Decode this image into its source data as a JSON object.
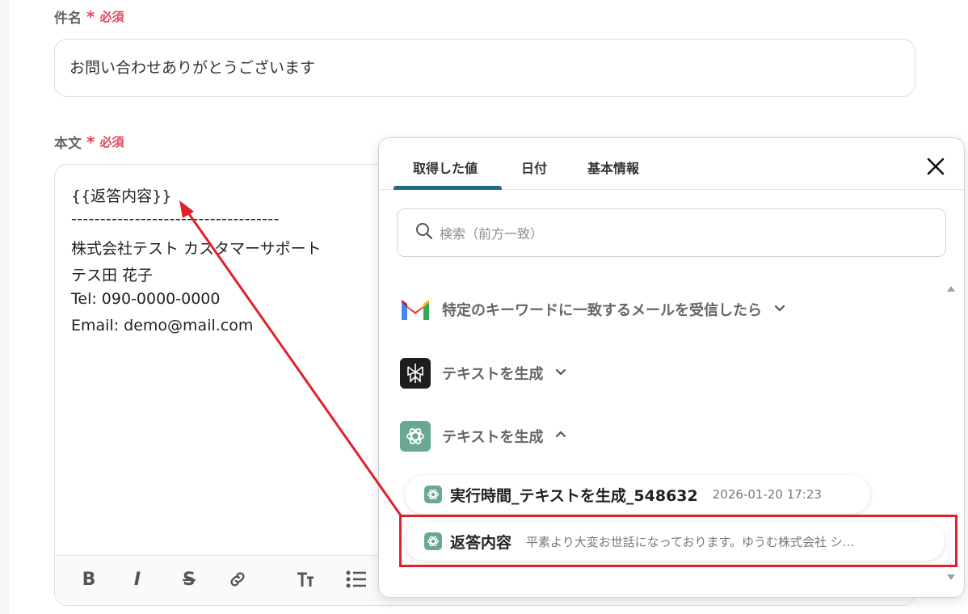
{
  "form": {
    "subject": {
      "label": "件名",
      "required_mark": "*",
      "required_text": "必須",
      "value": "お問い合わせありがとうございます"
    },
    "body": {
      "label": "本文",
      "required_mark": "*",
      "required_text": "必須",
      "lines": [
        "{{返答内容}}",
        "------------------------------------",
        "株式会社テスト カスタマーサポート",
        "テス田 花子",
        "Tel: 090-0000-0000",
        "Email: demo@mail.com"
      ]
    },
    "toolbar": [
      "bold-icon",
      "italic-icon",
      "strikethrough-icon",
      "link-icon",
      "text-size-icon",
      "list-icon"
    ]
  },
  "popup": {
    "tabs": [
      "取得した値",
      "日付",
      "基本情報"
    ],
    "active_tab": "取得した値",
    "search_placeholder": "検索（前方一致）",
    "groups": [
      {
        "title": "特定のキーワードに一致するメールを受信したら",
        "icon": "gmail-icon",
        "expanded": false
      },
      {
        "title": "テキストを生成",
        "icon": "perplexity-icon",
        "expanded": false
      },
      {
        "title": "テキストを生成",
        "icon": "openai-icon",
        "expanded": true
      }
    ],
    "items": [
      {
        "name": "実行時間_テキストを生成_548632",
        "value": "2026-01-20 17:23"
      },
      {
        "name": "返答内容",
        "value": "平素より大変お世話になっております。ゆうむ株式会社 シ..."
      }
    ]
  },
  "colors": {
    "accent": "#1f6d84",
    "required": "#e0475a",
    "annotation": "#e0202a"
  }
}
